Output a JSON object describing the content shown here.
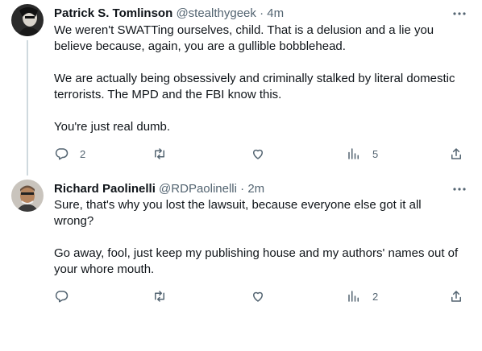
{
  "tweets": [
    {
      "name": "Patrick S. Tomlinson",
      "handle": "@stealthygeek",
      "separator": "·",
      "time": "4m",
      "paragraphs": [
        "We weren't SWATTing ourselves, child. That is a delusion and a lie you believe because, again, you are a gullible bobblehead.",
        "We are actually being obsessively and criminally stalked by literal domestic terrorists. The MPD and the FBI know this.",
        "You're just real dumb."
      ],
      "replies": "2",
      "retweets": "",
      "likes": "",
      "views": "5",
      "icons": [
        "reply-icon",
        "retweet-icon",
        "like-icon",
        "views-icon",
        "share-icon",
        "more-icon"
      ]
    },
    {
      "name": "Richard Paolinelli",
      "handle": "@RDPaolinelli",
      "separator": "·",
      "time": "2m",
      "paragraphs": [
        "Sure, that's why you lost the lawsuit, because everyone else got it all wrong?",
        "Go away, fool, just keep my publishing house and my authors' names out of your whore mouth."
      ],
      "replies": "",
      "retweets": "",
      "likes": "",
      "views": "2",
      "icons": [
        "reply-icon",
        "retweet-icon",
        "like-icon",
        "views-icon",
        "share-icon",
        "more-icon"
      ]
    }
  ],
  "colors": {
    "text": "#0f1419",
    "secondary": "#536471",
    "thread_line": "#cfd9de",
    "background": "#ffffff"
  }
}
